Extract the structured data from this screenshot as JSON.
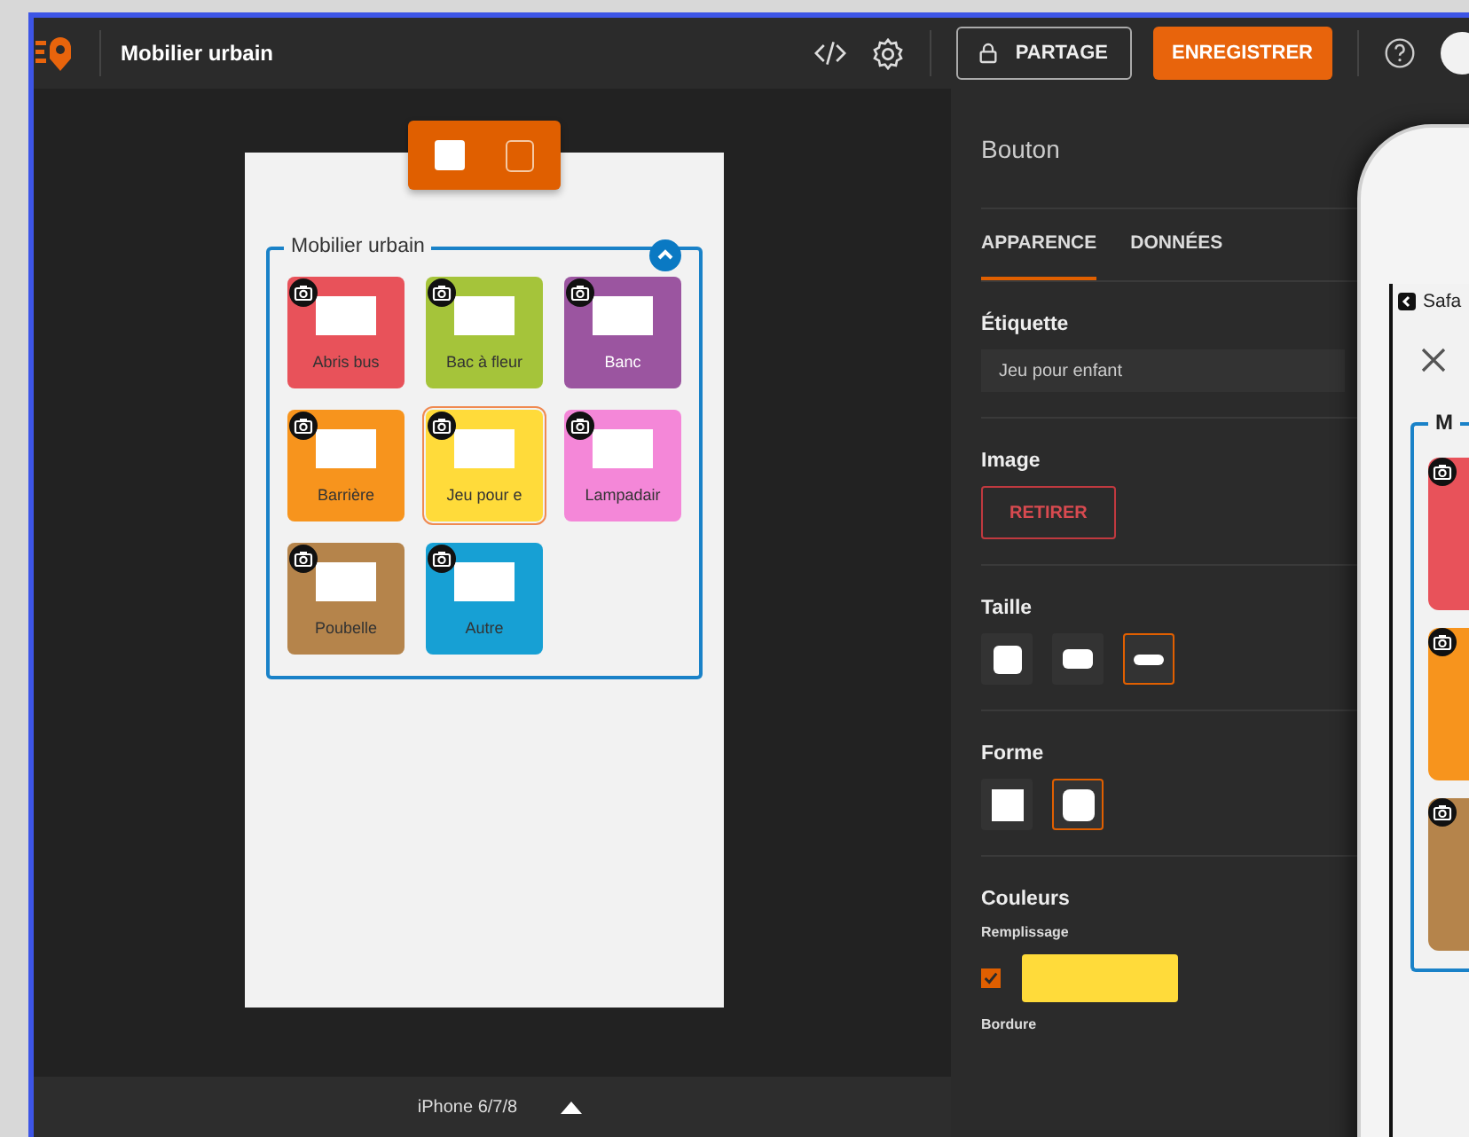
{
  "app_bar": {
    "title": "Mobilier urbain",
    "share_label": "PARTAGE",
    "save_label": "ENREGISTRER"
  },
  "preview": {
    "group": {
      "title": "Mobilier urbain",
      "expanded": true,
      "buttons": [
        {
          "label": "Abris bus",
          "color": "#e8525a",
          "light_text": false,
          "selected": false
        },
        {
          "label": "Bac à fleur",
          "color": "#a5c43a",
          "light_text": false,
          "selected": false
        },
        {
          "label": "Banc",
          "color": "#9b55a0",
          "light_text": true,
          "selected": false
        },
        {
          "label": "Barrière",
          "color": "#f7941d",
          "light_text": false,
          "selected": false
        },
        {
          "label": "Jeu pour e",
          "color": "#ffdb3a",
          "light_text": false,
          "selected": true
        },
        {
          "label": "Lampadair",
          "color": "#f487d8",
          "light_text": false,
          "selected": false
        },
        {
          "label": "Poubelle",
          "color": "#b5844b",
          "light_text": false,
          "selected": false
        },
        {
          "label": "Autre",
          "color": "#17a0d4",
          "light_text": false,
          "selected": false
        }
      ]
    }
  },
  "device": {
    "label": "iPhone 6/7/8"
  },
  "panel": {
    "title": "Bouton",
    "tabs": [
      {
        "label": "APPARENCE",
        "selected": true
      },
      {
        "label": "DONNÉES",
        "selected": false
      }
    ],
    "label_field": {
      "label": "Étiquette",
      "value": "Jeu pour enfant"
    },
    "image": {
      "label": "Image",
      "remove_label": "RETIRER"
    },
    "size": {
      "label": "Taille",
      "options": [
        {
          "kind": "large",
          "selected": false
        },
        {
          "kind": "medium",
          "selected": false
        },
        {
          "kind": "small",
          "selected": true
        }
      ]
    },
    "shape": {
      "label": "Forme",
      "options": [
        {
          "kind": "square",
          "selected": false
        },
        {
          "kind": "rounded",
          "selected": true
        }
      ]
    },
    "colors": {
      "label": "Couleurs",
      "fill": {
        "label": "Remplissage",
        "checked": true,
        "color": "#ffdb3a"
      },
      "border_label": "Bordure"
    }
  },
  "phone_overlay": {
    "back_label": "Safa",
    "group_title": "M",
    "tiles": [
      {
        "color": "#e8525a"
      },
      {
        "color": "#f7941d"
      },
      {
        "color": "#b5844b"
      }
    ]
  }
}
